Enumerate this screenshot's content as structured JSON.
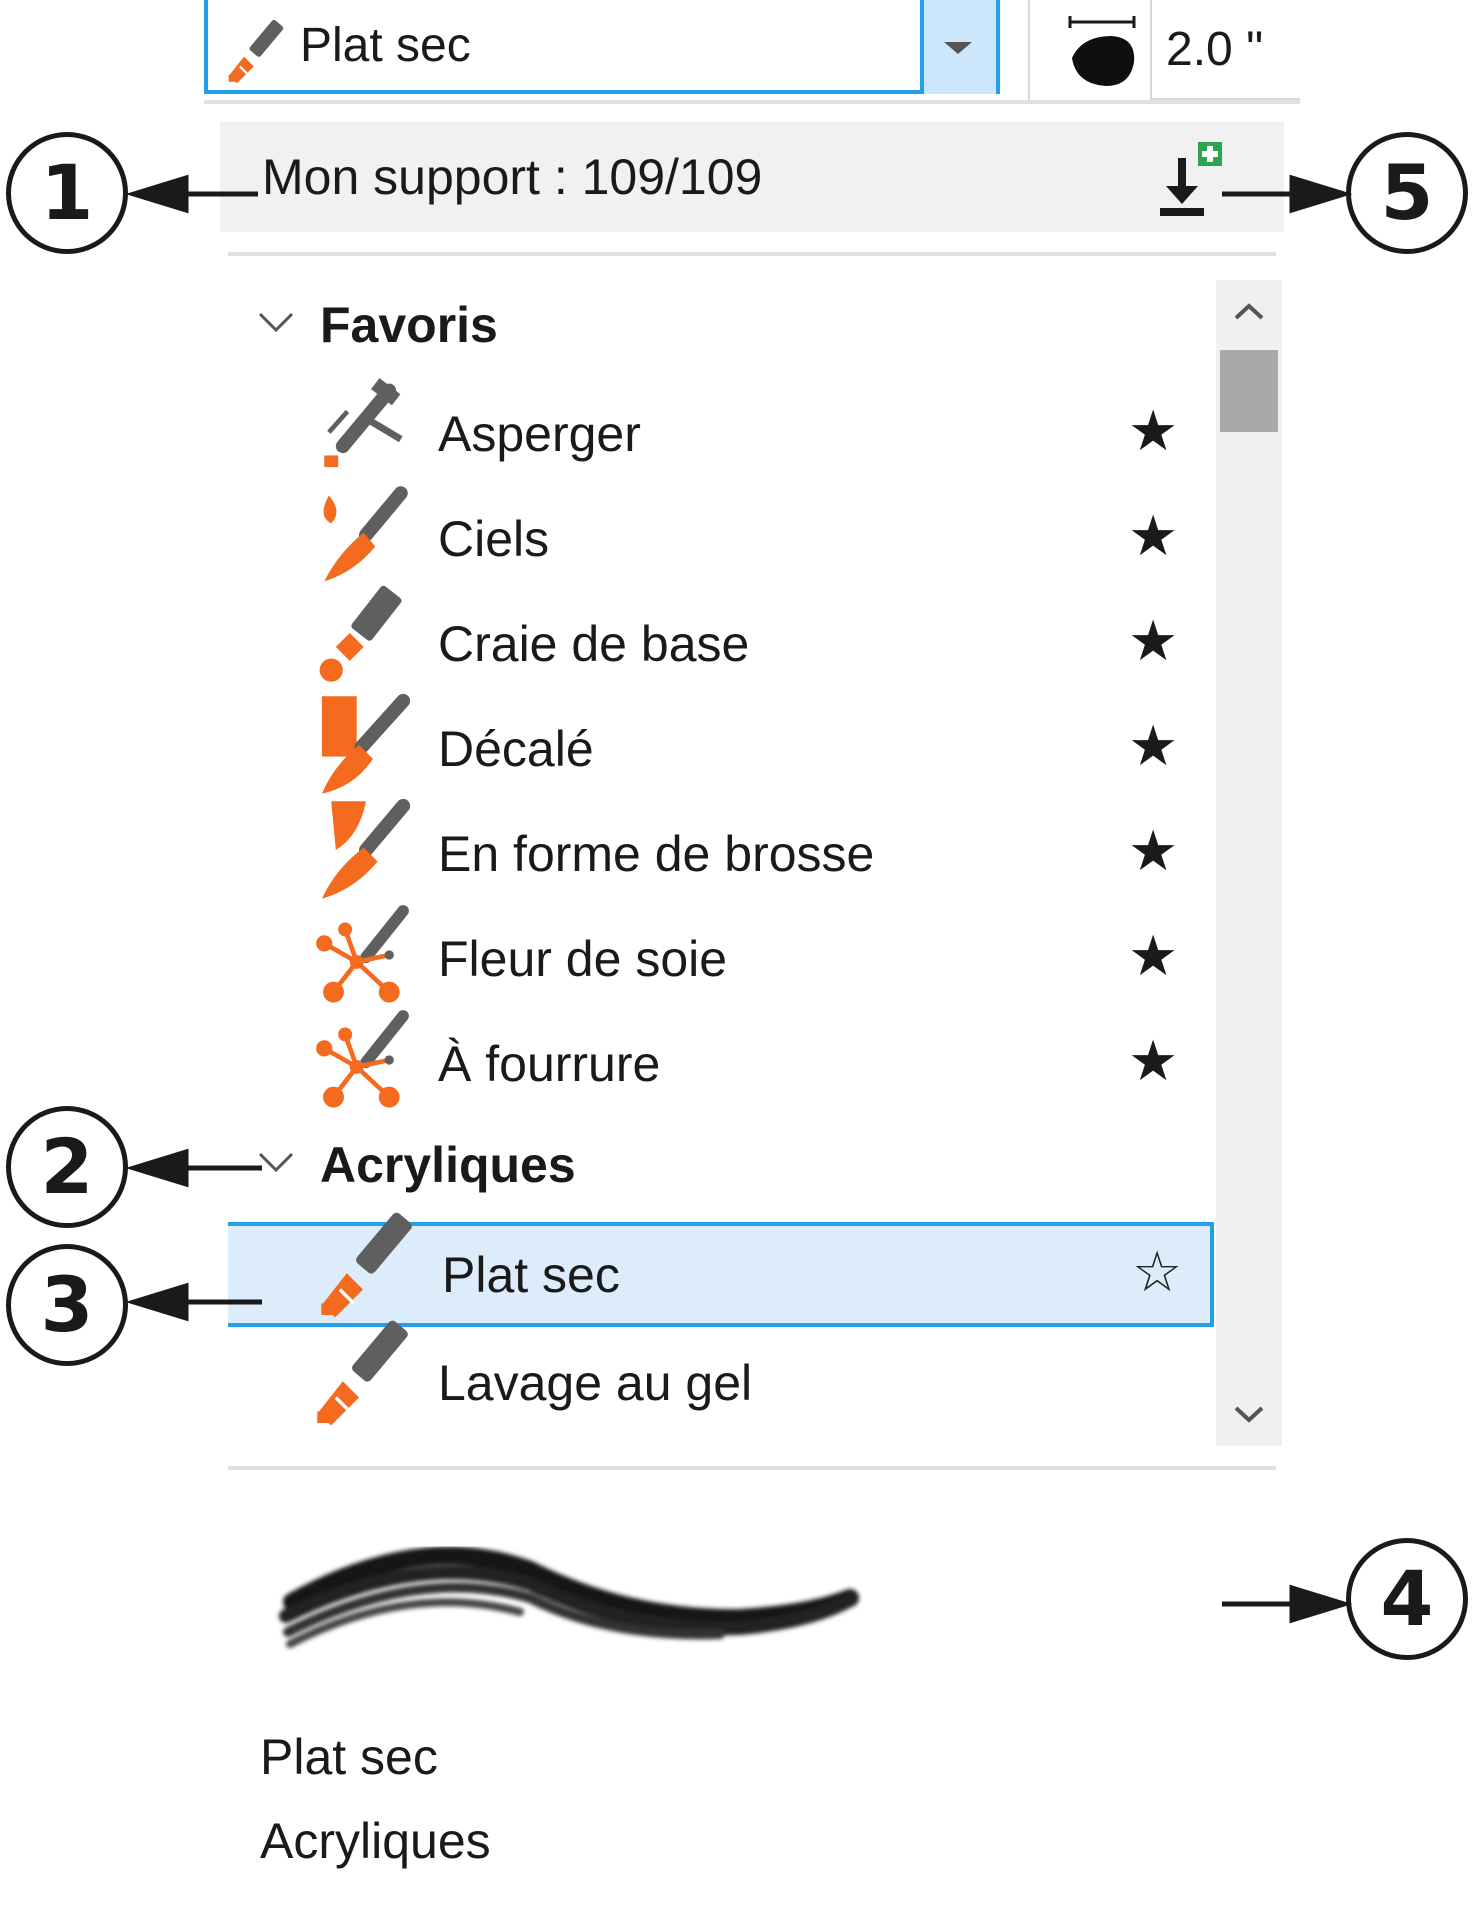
{
  "toolbar": {
    "brush_selector": {
      "value": "Plat sec",
      "icon": "flat-brush-icon"
    },
    "nib_icon": "nib-shape-icon",
    "size_value": "2.0 \""
  },
  "support": {
    "label": "Mon support : 109/109",
    "import_icon": "import-brush-icon"
  },
  "groups": [
    {
      "title": "Favoris",
      "items": [
        {
          "name": "Asperger",
          "icon": "spray-brush-icon",
          "favorite": "★"
        },
        {
          "name": "Ciels",
          "icon": "sky-brush-icon",
          "favorite": "★"
        },
        {
          "name": "Craie de base",
          "icon": "chalk-brush-icon",
          "favorite": "★"
        },
        {
          "name": "Décalé",
          "icon": "offset-brush-icon",
          "favorite": "★"
        },
        {
          "name": "En forme de brosse",
          "icon": "bristle-brush-icon",
          "favorite": "★"
        },
        {
          "name": "Fleur de soie",
          "icon": "silk-flower-brush-icon",
          "favorite": "★"
        },
        {
          "name": "À fourrure",
          "icon": "fur-brush-icon",
          "favorite": "★"
        }
      ]
    },
    {
      "title": "Acryliques",
      "items": [
        {
          "name": "Plat sec",
          "icon": "flat-brush-icon",
          "favorite": "☆",
          "selected": true
        },
        {
          "name": "Lavage au gel",
          "icon": "gel-wash-brush-icon",
          "favorite": ""
        }
      ]
    }
  ],
  "preview": {
    "stroke_icon": "brush-stroke-preview",
    "name": "Plat sec",
    "category": "Acryliques"
  },
  "callouts": [
    "1",
    "2",
    "3",
    "4",
    "5"
  ],
  "colors": {
    "accent": "#23a1e6",
    "selected_bg": "#dcecfb",
    "brush_orange": "#f46a1e",
    "brush_gray": "#5f5f5f"
  }
}
